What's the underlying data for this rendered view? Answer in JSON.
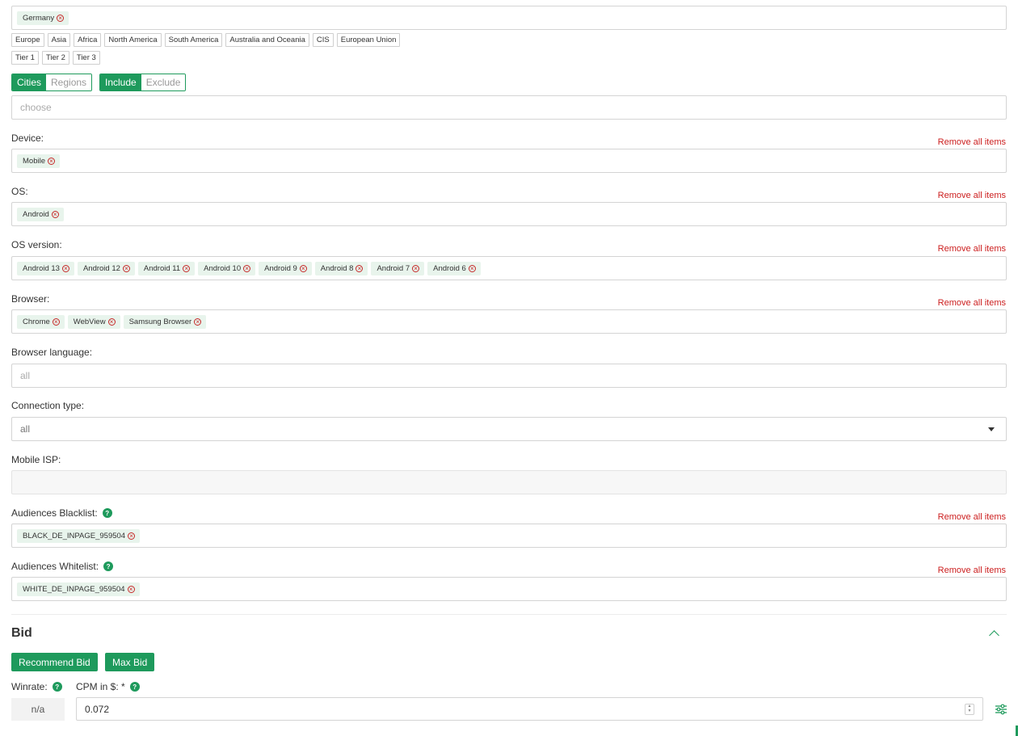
{
  "remove_all_label": "Remove all items",
  "geo": {
    "countries": [
      "Germany"
    ],
    "presets_row1": [
      "Europe",
      "Asia",
      "Africa",
      "North America",
      "South America",
      "Australia and Oceania",
      "CIS",
      "European Union"
    ],
    "presets_row2": [
      "Tier 1",
      "Tier 2",
      "Tier 3"
    ],
    "scope_toggle": [
      "Cities",
      "Regions"
    ],
    "mode_toggle": [
      "Include",
      "Exclude"
    ],
    "city_placeholder": "choose"
  },
  "fields": {
    "device": {
      "label": "Device:",
      "tags": [
        "Mobile"
      ]
    },
    "os": {
      "label": "OS:",
      "tags": [
        "Android"
      ]
    },
    "os_version": {
      "label": "OS version:",
      "tags": [
        "Android 13",
        "Android 12",
        "Android 11",
        "Android 10",
        "Android 9",
        "Android 8",
        "Android 7",
        "Android 6"
      ]
    },
    "browser": {
      "label": "Browser:",
      "tags": [
        "Chrome",
        "WebView",
        "Samsung Browser"
      ]
    },
    "browser_language": {
      "label": "Browser language:",
      "placeholder": "all"
    },
    "connection_type": {
      "label": "Connection type:",
      "value": "all"
    },
    "mobile_isp": {
      "label": "Mobile ISP:"
    },
    "audiences_blacklist": {
      "label": "Audiences Blacklist:",
      "tags": [
        "BLACK_DE_INPAGE_959504"
      ]
    },
    "audiences_whitelist": {
      "label": "Audiences Whitelist:",
      "tags": [
        "WHITE_DE_INPAGE_959504"
      ]
    }
  },
  "bid": {
    "title": "Bid",
    "recommend_label": "Recommend Bid",
    "max_label": "Max Bid",
    "winrate_label": "Winrate:",
    "cpm_label": "CPM in $: *",
    "winrate_value": "n/a",
    "cpm_value": "0.072"
  },
  "help_glyph": "?",
  "remove_glyph": "×",
  "icons": {
    "remove": "x-circle-icon",
    "help": "question-circle-icon",
    "collapse": "chevron-up-icon",
    "settings": "sliders-icon",
    "dropdown": "caret-down-icon"
  },
  "colors": {
    "accent": "#1e9a5c",
    "danger": "#cc1f1f",
    "tag_bg": "#e8f4ec"
  }
}
